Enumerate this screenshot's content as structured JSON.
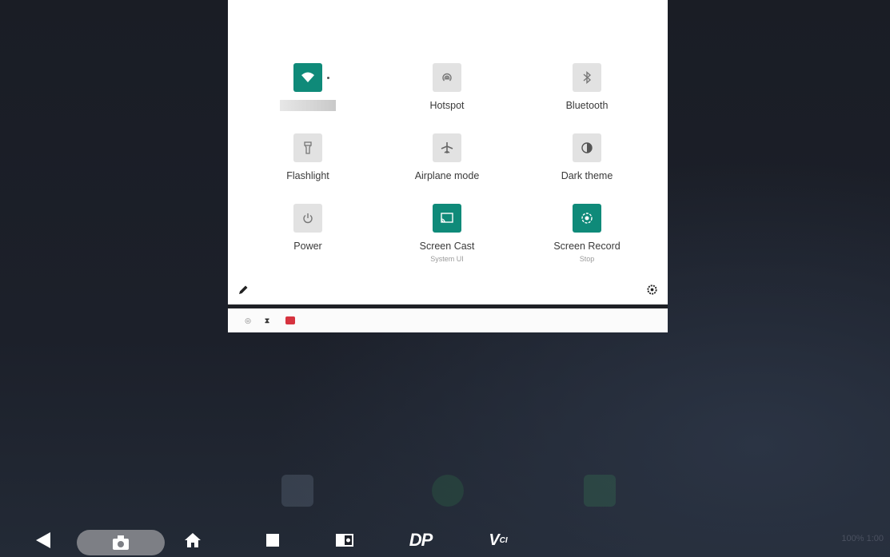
{
  "quick_settings": {
    "tiles": [
      {
        "id": "wifi",
        "label": "",
        "sub": "",
        "active": true,
        "icon": "wifi-icon"
      },
      {
        "id": "hotspot",
        "label": "Hotspot",
        "sub": "",
        "active": false,
        "icon": "hotspot-icon"
      },
      {
        "id": "bluetooth",
        "label": "Bluetooth",
        "sub": "",
        "active": false,
        "icon": "bluetooth-icon"
      },
      {
        "id": "flashlight",
        "label": "Flashlight",
        "sub": "",
        "active": false,
        "icon": "flashlight-icon"
      },
      {
        "id": "airplane",
        "label": "Airplane mode",
        "sub": "",
        "active": false,
        "icon": "airplane-icon"
      },
      {
        "id": "dark_theme",
        "label": "Dark theme",
        "sub": "",
        "active": false,
        "icon": "dark-theme-icon"
      },
      {
        "id": "power",
        "label": "Power",
        "sub": "",
        "active": false,
        "icon": "power-icon"
      },
      {
        "id": "screen_cast",
        "label": "Screen Cast",
        "sub": "System UI",
        "active": true,
        "icon": "cast-icon"
      },
      {
        "id": "screen_record",
        "label": "Screen Record",
        "sub": "Stop",
        "active": true,
        "icon": "record-icon"
      }
    ],
    "active_color": "#0f8a79",
    "inactive_color": "#e2e2e2"
  },
  "notifications": {
    "icons": [
      "location-icon",
      "hourglass-icon",
      "app-notification-icon"
    ]
  },
  "navbar": {
    "dp_label": "DP",
    "vci_label": "V",
    "vci_sub": "CI"
  },
  "status": {
    "text": "100%  1:00"
  }
}
